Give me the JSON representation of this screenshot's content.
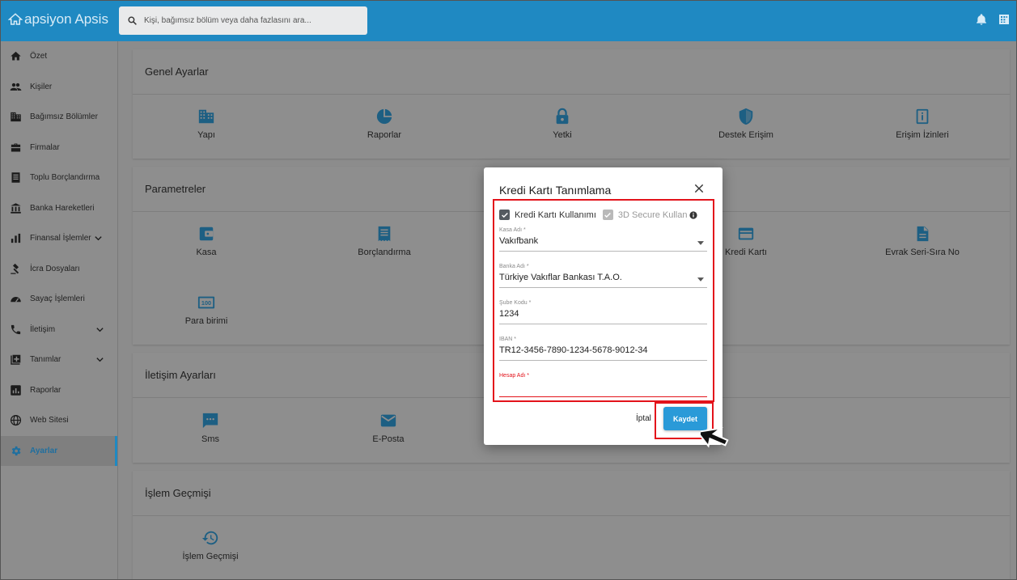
{
  "app": {
    "logo_text": "apsiyon Apsis"
  },
  "search": {
    "placeholder": "Kişi, bağımsız bölüm veya daha fazlasını ara..."
  },
  "colors": {
    "brand": "#1f89c2",
    "accent": "#2a9ad8",
    "highlight": "#e3131b"
  },
  "sidebar": {
    "items": [
      {
        "label": "Özet",
        "icon": "home-icon"
      },
      {
        "label": "Kişiler",
        "icon": "people-icon"
      },
      {
        "label": "Bağımsız Bölümler",
        "icon": "building-icon"
      },
      {
        "label": "Firmalar",
        "icon": "briefcase-icon"
      },
      {
        "label": "Toplu Borçlandırma",
        "icon": "document-list-icon"
      },
      {
        "label": "Banka Hareketleri",
        "icon": "bank-icon"
      },
      {
        "label": "Finansal İşlemler",
        "icon": "bar-chart-icon",
        "expandable": true
      },
      {
        "label": "İcra Dosyaları",
        "icon": "gavel-icon"
      },
      {
        "label": "Sayaç İşlemleri",
        "icon": "gauge-icon"
      },
      {
        "label": "İletişim",
        "icon": "phone-icon",
        "expandable": true
      },
      {
        "label": "Tanımlar",
        "icon": "add-box-icon",
        "expandable": true
      },
      {
        "label": "Raporlar",
        "icon": "report-icon"
      },
      {
        "label": "Web Sitesi",
        "icon": "globe-icon"
      },
      {
        "label": "Ayarlar",
        "icon": "gear-icon",
        "active": true
      }
    ]
  },
  "sections": {
    "genel": {
      "title": "Genel Ayarlar",
      "tiles": [
        "Yapı",
        "Raporlar",
        "Yetki",
        "Destek Erişim",
        "Erişim İzinleri"
      ]
    },
    "parametreler": {
      "title": "Parametreler",
      "tiles": [
        "Kasa",
        "Borçlandırma",
        "Kredi Kartı",
        "Evrak Seri-Sıra No",
        "Para birimi"
      ]
    },
    "iletisim": {
      "title": "İletişim Ayarları",
      "tiles": [
        "Sms",
        "E-Posta"
      ]
    },
    "islem": {
      "title": "İşlem Geçmişi",
      "tiles": [
        "İşlem Geçmişi"
      ]
    }
  },
  "modal": {
    "title": "Kredi Kartı Tanımlama",
    "checkbox1_label": "Kredi Kartı Kullanımı",
    "checkbox1_checked": true,
    "checkbox2_label": "3D Secure Kullan",
    "checkbox2_checked": true,
    "fields": {
      "kasa_label": "Kasa Adı *",
      "kasa_value": "Vakıfbank",
      "banka_label": "Banka Adı *",
      "banka_value": "Türkiye Vakıflar Bankası T.A.O.",
      "sube_label": "Şube Kodu *",
      "sube_value": "1234",
      "iban_label": "IBAN *",
      "iban_value": "TR12-3456-7890-1234-5678-9012-34",
      "hesap_label": "Hesap Adı *",
      "hesap_value": ""
    },
    "cancel_label": "İptal",
    "save_label": "Kaydet"
  }
}
